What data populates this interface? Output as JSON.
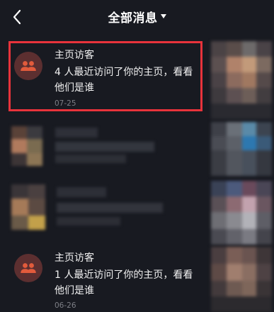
{
  "header": {
    "title": "全部消息"
  },
  "messages": [
    {
      "title": "主页访客",
      "body": "4 人最近访问了你的主页，看看他们是谁",
      "time": "07-25",
      "avatar_color": "#5c2f30",
      "icon_color": "#e25b3c",
      "highlighted": true
    },
    {
      "title": "主页访客",
      "body": "1 人最近访问了你的主页，看看他们是谁",
      "time": "06-26",
      "avatar_color": "#5c2f30",
      "icon_color": "#e25b3c",
      "highlighted": false
    }
  ],
  "colors": {
    "background": "#181a21",
    "highlight": "#e8333b",
    "time_text": "#7d7f86"
  }
}
